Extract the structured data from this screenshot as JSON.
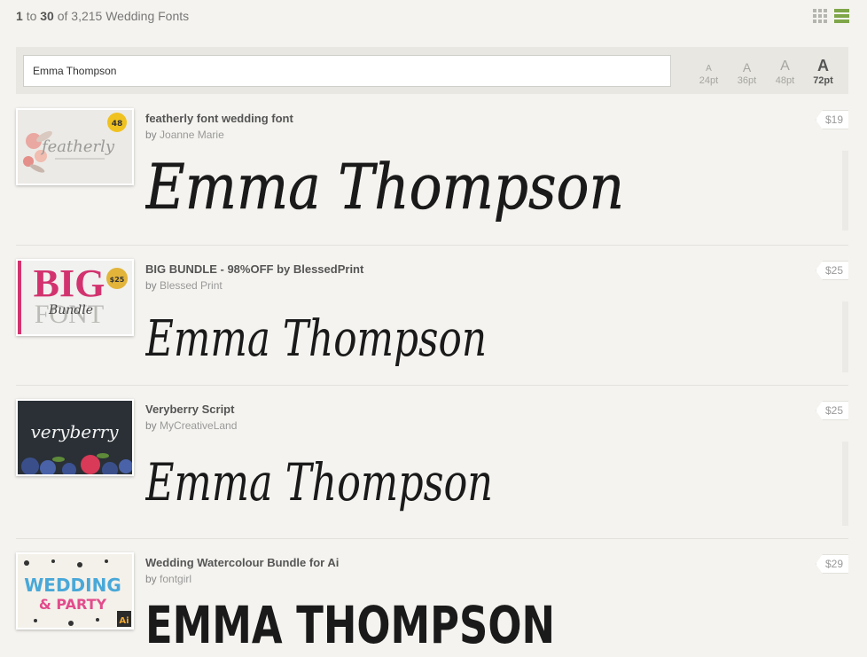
{
  "results": {
    "start": "1",
    "to_word": "to",
    "end": "30",
    "of_text": "of 3,215 Wedding Fonts"
  },
  "search": {
    "value": "Emma Thompson"
  },
  "sizes": [
    {
      "glyph": "A",
      "label": "24pt"
    },
    {
      "glyph": "A",
      "label": "36pt"
    },
    {
      "glyph": "A",
      "label": "48pt"
    },
    {
      "glyph": "A",
      "label": "72pt"
    }
  ],
  "fonts": [
    {
      "title": "featherly font wedding font",
      "by": "by",
      "author": "Joanne Marie",
      "price": "$19",
      "preview": "Emma Thompson",
      "thumb_text": "featherly",
      "thumb_badge": "48"
    },
    {
      "title": "BIG BUNDLE - 98%OFF by BlessedPrint",
      "by": "by",
      "author": "Blessed Print",
      "price": "$25",
      "preview": "Emma Thompson",
      "thumb_text": "BIG",
      "thumb_text2": "FONT",
      "thumb_script": "Bundle",
      "thumb_badge": "$25"
    },
    {
      "title": "Veryberry Script",
      "by": "by",
      "author": "MyCreativeLand",
      "price": "$25",
      "preview": "Emma Thompson",
      "thumb_text": "veryberry"
    },
    {
      "title": "Wedding Watercolour Bundle for Ai",
      "by": "by",
      "author": "fontgirl",
      "price": "$29",
      "preview": "EMMA THOMPSON",
      "thumb_text": "WEDDING",
      "thumb_text2": "& PARTY",
      "thumb_badge": "Ai"
    }
  ]
}
